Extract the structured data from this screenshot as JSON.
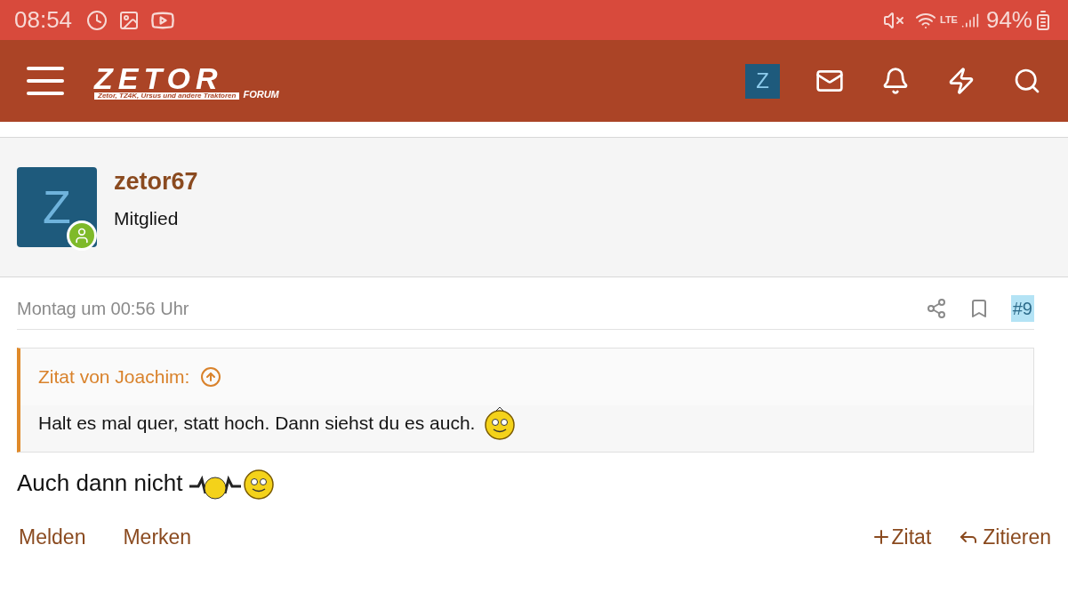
{
  "status_bar": {
    "time": "08:54",
    "network": "LTE",
    "battery": "94%"
  },
  "nav": {
    "logo": {
      "name": "ZETOR",
      "tagline": "Zetor, TZ4K, Ursus und andere Traktoren",
      "sub": "FORUM"
    },
    "avatar_letter": "Z"
  },
  "author": {
    "avatar_letter": "Z",
    "name": "zetor67",
    "role": "Mitglied",
    "online": true
  },
  "post": {
    "date": "Montag um 00:56 Uhr",
    "number": "#9",
    "quote": {
      "title": "Zitat von Joachim:",
      "text": "Halt es mal quer, statt hoch. Dann siehst du es auch."
    },
    "text": "Auch dann nicht",
    "actions_left": [
      "Melden",
      "Merken"
    ],
    "actions_right": [
      {
        "kind": "plus",
        "label": "Zitat"
      },
      {
        "kind": "reply",
        "label": "Zitieren"
      }
    ]
  }
}
